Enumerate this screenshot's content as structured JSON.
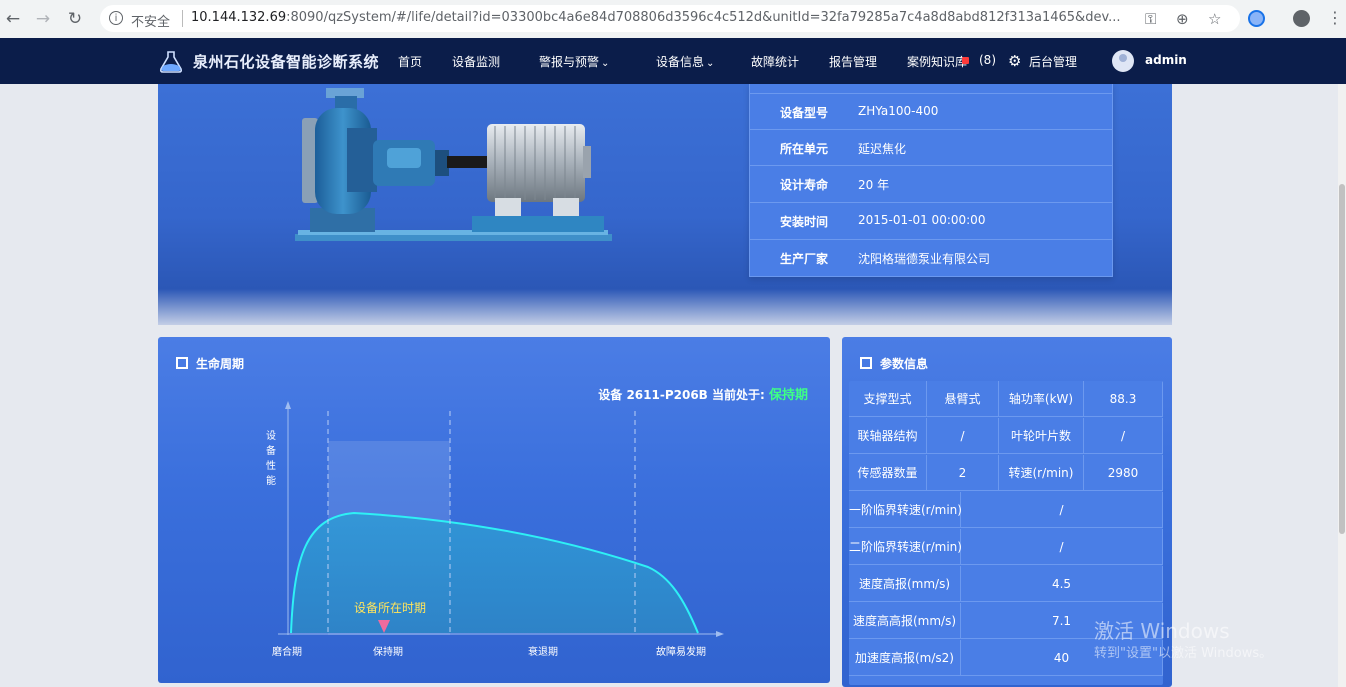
{
  "browser": {
    "security_label": "不安全",
    "url_host": "10.144.132.69",
    "url_rest": ":8090/qzSystem/#/life/detail?id=03300bc4a6e84d708806d3596c4c512d&unitId=32fa79285a7c4a8d8abd812f313a1465&dev..."
  },
  "nav": {
    "brand": "泉州石化设备智能诊断系统",
    "items": [
      "首页",
      "设备监测",
      "警报与预警",
      "设备信息",
      "故障统计",
      "报告管理",
      "案例知识库"
    ],
    "badge": "(8)",
    "admin_label": "后台管理",
    "user": "admin"
  },
  "device_info": [
    {
      "label": "设备型号",
      "value": "ZHYa100-400"
    },
    {
      "label": "所在单元",
      "value": "延迟焦化"
    },
    {
      "label": "设计寿命",
      "value": "20 年"
    },
    {
      "label": "安装时间",
      "value": "2015-01-01 00:00:00"
    },
    {
      "label": "生产厂家",
      "value": "沈阳格瑞德泵业有限公司"
    }
  ],
  "lifecycle": {
    "title": "生命周期",
    "status_prefix": "设备 2611-P206B  当前处于:",
    "status_value": "保持期",
    "y_label": "设备性能",
    "marker_label": "设备所在时期",
    "phases": [
      "磨合期",
      "保持期",
      "衰退期",
      "故障易发期"
    ],
    "status_color": "#3dff86"
  },
  "params": {
    "title": "参数信息",
    "rows4": [
      [
        "支撑型式",
        "悬臂式",
        "轴功率(kW)",
        "88.3"
      ],
      [
        "联轴器结构",
        "/",
        "叶轮叶片数",
        "/"
      ],
      [
        "传感器数量",
        "2",
        "转速(r/min)",
        "2980"
      ]
    ],
    "rows2": [
      [
        "一阶临界转速(r/min)",
        "/"
      ],
      [
        "二阶临界转速(r/min)",
        "/"
      ],
      [
        "速度高报(mm/s)",
        "4.5"
      ],
      [
        "速度高高报(mm/s)",
        "7.1"
      ],
      [
        "加速度高报(m/s2)",
        "40"
      ]
    ]
  },
  "watermark": {
    "line1": "激活 Windows",
    "line2": "转到\"设置\"以激活 Windows。"
  }
}
